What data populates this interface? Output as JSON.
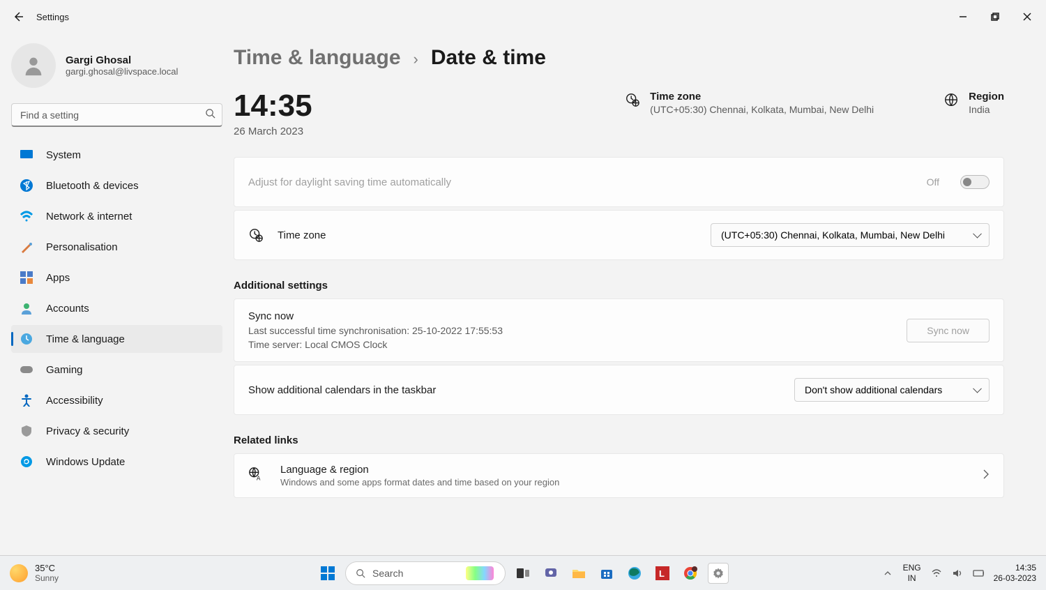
{
  "window": {
    "title": "Settings"
  },
  "user": {
    "name": "Gargi Ghosal",
    "email": "gargi.ghosal@livspace.local"
  },
  "search": {
    "placeholder": "Find a setting"
  },
  "nav": {
    "items": [
      {
        "label": "System"
      },
      {
        "label": "Bluetooth & devices"
      },
      {
        "label": "Network & internet"
      },
      {
        "label": "Personalisation"
      },
      {
        "label": "Apps"
      },
      {
        "label": "Accounts"
      },
      {
        "label": "Time & language"
      },
      {
        "label": "Gaming"
      },
      {
        "label": "Accessibility"
      },
      {
        "label": "Privacy & security"
      },
      {
        "label": "Windows Update"
      }
    ]
  },
  "breadcrumb": {
    "parent": "Time & language",
    "current": "Date & time"
  },
  "clock": {
    "time": "14:35",
    "date": "26 March 2023"
  },
  "tz_header": {
    "title": "Time zone",
    "value": "(UTC+05:30) Chennai, Kolkata, Mumbai, New Delhi"
  },
  "region_header": {
    "title": "Region",
    "value": "India"
  },
  "daylight": {
    "label": "Adjust for daylight saving time automatically",
    "state": "Off"
  },
  "timezone_row": {
    "label": "Time zone",
    "value": "(UTC+05:30) Chennai, Kolkata, Mumbai, New Delhi"
  },
  "sections": {
    "additional": "Additional settings",
    "related": "Related links"
  },
  "sync": {
    "title": "Sync now",
    "last": "Last successful time synchronisation: 25-10-2022 17:55:53",
    "server": "Time server: Local CMOS Clock",
    "button": "Sync now"
  },
  "calendars_row": {
    "label": "Show additional calendars in the taskbar",
    "value": "Don't show additional calendars"
  },
  "link_lang": {
    "title": "Language & region",
    "sub": "Windows and some apps format dates and time based on your region"
  },
  "taskbar": {
    "weather": {
      "temp": "35°C",
      "cond": "Sunny"
    },
    "search": "Search",
    "lang1": "ENG",
    "lang2": "IN",
    "time": "14:35",
    "date": "26-03-2023"
  }
}
